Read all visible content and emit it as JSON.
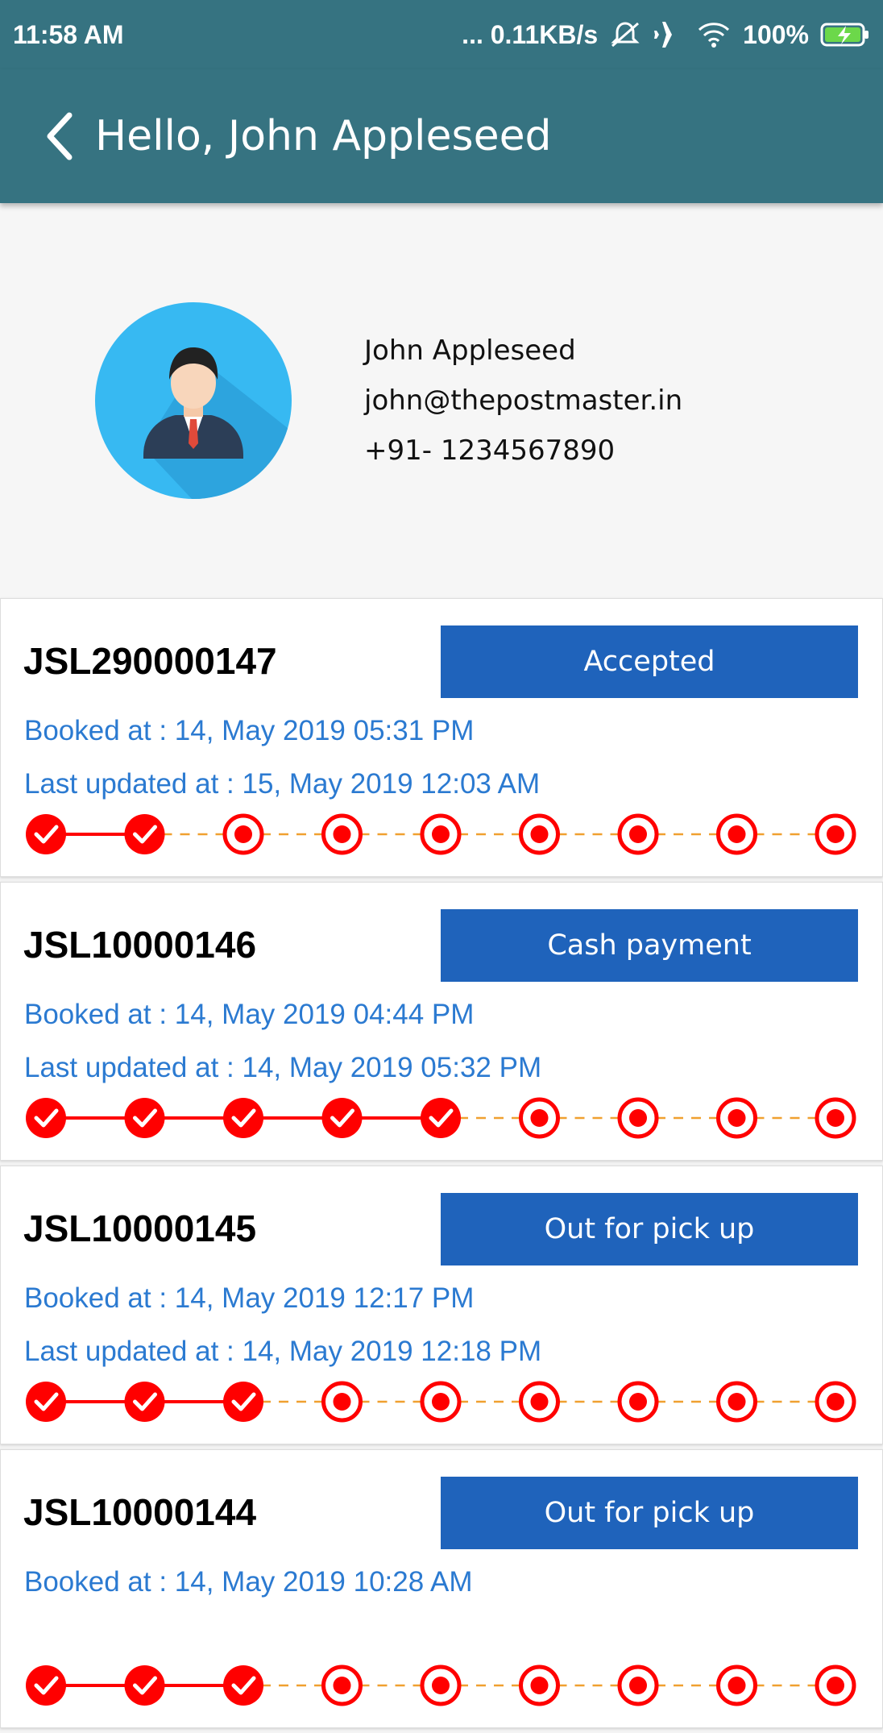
{
  "status_bar": {
    "time": "11:58 AM",
    "net_speed": "... 0.11KB/s",
    "battery": "100%"
  },
  "header": {
    "title": "Hello, John Appleseed"
  },
  "profile": {
    "name": "John Appleseed",
    "email": "john@thepostmaster.in",
    "phone": "+91- 1234567890"
  },
  "colors": {
    "appbar": "#367381",
    "status_button": "#1f63bb",
    "link_text": "#2b7ad1",
    "progress_red": "#ff0000",
    "dash_orange": "#f0a030"
  },
  "orders": [
    {
      "id": "JSL290000147",
      "status": "Accepted",
      "booked": "Booked at : 14, May 2019 05:31 PM",
      "updated": "Last updated at : 15, May 2019 12:03 AM",
      "completed_steps": 2,
      "total_steps": 9
    },
    {
      "id": "JSL10000146",
      "status": "Cash payment",
      "booked": "Booked at : 14, May 2019 04:44 PM",
      "updated": "Last updated at : 14, May 2019 05:32 PM",
      "completed_steps": 5,
      "total_steps": 9
    },
    {
      "id": "JSL10000145",
      "status": "Out for pick up",
      "booked": "Booked at : 14, May 2019 12:17 PM",
      "updated": "Last updated at : 14, May 2019 12:18 PM",
      "completed_steps": 3,
      "total_steps": 9
    },
    {
      "id": "JSL10000144",
      "status": "Out for pick up",
      "booked": "Booked at : 14, May 2019 10:28 AM",
      "updated": "",
      "completed_steps": 3,
      "total_steps": 9
    }
  ]
}
